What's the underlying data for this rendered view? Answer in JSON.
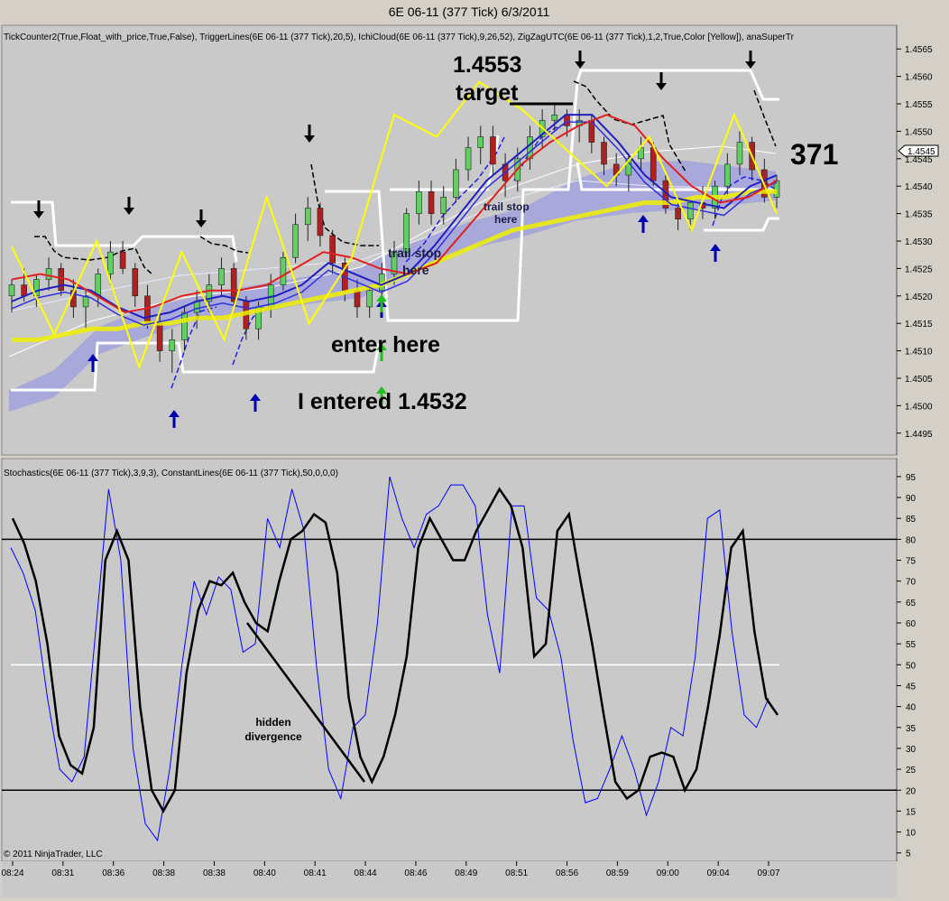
{
  "window": {
    "title": "6E 06-11 (377 Tick)  6/3/2011"
  },
  "price_panel": {
    "indicator_header": "TickCounter2(True,Float_with_price,True,False), TriggerLines(6E 06-11 (377 Tick),20,5), IchiCloud(6E 06-11 (377 Tick),9,26,52), ZigZagUTC(6E 06-11 (377 Tick),1,2,True,Color [Yellow]), anaSuperTr",
    "current_price_tag": "1.4545",
    "tick_counter": "371"
  },
  "stoch_panel": {
    "indicator_header": "Stochastics(6E 06-11 (377 Tick),3,9,3), ConstantLines(6E 06-11 (377 Tick),50,0,0,0)"
  },
  "annotations": {
    "target_price": "1.4553",
    "target_word": "target",
    "trail_stop_1_line1": "trail stop",
    "trail_stop_1_line2": "here",
    "trail_stop_2_line1": "trail stop",
    "trail_stop_2_line2": "here",
    "enter_here": "enter here",
    "entered": "I entered 1.4532",
    "hidden_div_line1": "hidden",
    "hidden_div_line2": "divergence"
  },
  "footer": {
    "copyright": "© 2011 NinjaTrader, LLC"
  },
  "chart_data": [
    {
      "type": "line",
      "panel": "price",
      "title": "6E 06-11 (377 Tick)  6/3/2011",
      "ylim": [
        1.4492,
        1.4568
      ],
      "yticks": [
        1.4495,
        1.45,
        1.4505,
        1.451,
        1.4515,
        1.452,
        1.4525,
        1.453,
        1.4535,
        1.454,
        1.4545,
        1.455,
        1.4555,
        1.456,
        1.4565
      ],
      "xticks": [
        "08:24",
        "08:31",
        "08:36",
        "08:38",
        "08:38",
        "08:40",
        "08:41",
        "08:44",
        "08:46",
        "08:49",
        "08:51",
        "08:56",
        "08:59",
        "09:00",
        "09:04",
        "09:07"
      ],
      "series": [
        {
          "color": "#000000",
          "ohlc": [
            [
              1.452,
              1.4523,
              1.4517,
              1.4522
            ],
            [
              1.4522,
              1.4525,
              1.4519,
              1.452
            ],
            [
              1.452,
              1.4524,
              1.4518,
              1.4523
            ],
            [
              1.4523,
              1.4527,
              1.4521,
              1.4525
            ],
            [
              1.4525,
              1.4526,
              1.452,
              1.4521
            ],
            [
              1.4521,
              1.4523,
              1.4516,
              1.4518
            ],
            [
              1.4518,
              1.4521,
              1.4514,
              1.452
            ],
            [
              1.452,
              1.4525,
              1.4518,
              1.4524
            ],
            [
              1.4524,
              1.453,
              1.4522,
              1.4528
            ],
            [
              1.4528,
              1.453,
              1.4524,
              1.4525
            ],
            [
              1.4525,
              1.4526,
              1.4518,
              1.452
            ],
            [
              1.452,
              1.4522,
              1.4514,
              1.4515
            ],
            [
              1.4515,
              1.4517,
              1.4508,
              1.451
            ],
            [
              1.451,
              1.4514,
              1.4506,
              1.4512
            ],
            [
              1.4512,
              1.4518,
              1.451,
              1.4517
            ],
            [
              1.4517,
              1.4521,
              1.4514,
              1.4519
            ],
            [
              1.4519,
              1.4524,
              1.4517,
              1.4522
            ],
            [
              1.4522,
              1.4527,
              1.452,
              1.4525
            ],
            [
              1.4525,
              1.4526,
              1.4518,
              1.4519
            ],
            [
              1.4519,
              1.452,
              1.4512,
              1.4514
            ],
            [
              1.4514,
              1.4519,
              1.4512,
              1.4518
            ],
            [
              1.4518,
              1.4524,
              1.4516,
              1.4522
            ],
            [
              1.4522,
              1.4528,
              1.4521,
              1.4527
            ],
            [
              1.4527,
              1.4535,
              1.4526,
              1.4533
            ],
            [
              1.4533,
              1.4538,
              1.453,
              1.4536
            ],
            [
              1.4536,
              1.4537,
              1.4529,
              1.4531
            ],
            [
              1.4531,
              1.4532,
              1.4524,
              1.4526
            ],
            [
              1.4526,
              1.4527,
              1.4519,
              1.4521
            ],
            [
              1.4521,
              1.4523,
              1.4516,
              1.4518
            ],
            [
              1.4518,
              1.4522,
              1.4516,
              1.4521
            ],
            [
              1.4521,
              1.4526,
              1.4519,
              1.4524
            ],
            [
              1.4524,
              1.453,
              1.4522,
              1.4528
            ],
            [
              1.4528,
              1.4536,
              1.4527,
              1.4535
            ],
            [
              1.4535,
              1.4541,
              1.4533,
              1.4539
            ],
            [
              1.4539,
              1.4541,
              1.4533,
              1.4535
            ],
            [
              1.4535,
              1.454,
              1.4533,
              1.4538
            ],
            [
              1.4538,
              1.4545,
              1.4537,
              1.4543
            ],
            [
              1.4543,
              1.4549,
              1.4541,
              1.4547
            ],
            [
              1.4547,
              1.4551,
              1.4544,
              1.4549
            ],
            [
              1.4549,
              1.4551,
              1.4542,
              1.4544
            ],
            [
              1.4544,
              1.4546,
              1.4538,
              1.4541
            ],
            [
              1.4541,
              1.4547,
              1.4539,
              1.4545
            ],
            [
              1.4545,
              1.4551,
              1.4543,
              1.4549
            ],
            [
              1.4549,
              1.4554,
              1.4547,
              1.4552
            ],
            [
              1.4552,
              1.4555,
              1.455,
              1.4553
            ],
            [
              1.4553,
              1.4554,
              1.4549,
              1.4551
            ],
            [
              1.4551,
              1.4554,
              1.4548,
              1.4552
            ],
            [
              1.4552,
              1.4553,
              1.4546,
              1.4548
            ],
            [
              1.4548,
              1.4549,
              1.4542,
              1.4544
            ],
            [
              1.4544,
              1.4546,
              1.454,
              1.4542
            ],
            [
              1.4542,
              1.4546,
              1.4539,
              1.4545
            ],
            [
              1.4545,
              1.4549,
              1.4543,
              1.4547
            ],
            [
              1.4547,
              1.4548,
              1.454,
              1.4541
            ],
            [
              1.4541,
              1.4542,
              1.4535,
              1.4536
            ],
            [
              1.4536,
              1.4538,
              1.4532,
              1.4534
            ],
            [
              1.4534,
              1.4538,
              1.4532,
              1.4537
            ],
            [
              1.4537,
              1.454,
              1.4534,
              1.4536
            ],
            [
              1.4536,
              1.4541,
              1.4534,
              1.454
            ],
            [
              1.454,
              1.4546,
              1.4538,
              1.4544
            ],
            [
              1.4544,
              1.455,
              1.4542,
              1.4548
            ],
            [
              1.4548,
              1.4549,
              1.4541,
              1.4543
            ],
            [
              1.4543,
              1.4545,
              1.4537,
              1.4538
            ],
            [
              1.4538,
              1.4542,
              1.4536,
              1.4541
            ]
          ]
        },
        {
          "name_hidden": true,
          "color": "#f0f000",
          "values": [
            1.4512,
            1.4512,
            1.4513,
            1.4514,
            1.4514,
            1.4515,
            1.4515,
            1.4516,
            1.4516,
            1.4517,
            1.4518,
            1.4519,
            1.452,
            1.4521,
            1.4522,
            1.4524,
            1.4526,
            1.4528,
            1.453,
            1.4532,
            1.4533,
            1.4534,
            1.4535,
            1.4536,
            1.4537,
            1.4537,
            1.4538,
            1.4538,
            1.4539,
            1.4539
          ]
        },
        {
          "color": "#3030d0",
          "values": [
            1.4519,
            1.4521,
            1.4522,
            1.4521,
            1.4518,
            1.4516,
            1.4517,
            1.4519,
            1.452,
            1.4519,
            1.452,
            1.4522,
            1.4526,
            1.4524,
            1.4522,
            1.4524,
            1.4529,
            1.4535,
            1.4541,
            1.4545,
            1.4549,
            1.4553,
            1.4553,
            1.4548,
            1.4542,
            1.4538,
            1.4537,
            1.4536,
            1.454,
            1.4542
          ]
        },
        {
          "color": "#e02020",
          "values": [
            1.4523,
            1.4524,
            1.4523,
            1.452,
            1.4517,
            1.4518,
            1.452,
            1.4521,
            1.4521,
            1.4522,
            1.4525,
            1.4528,
            1.4527,
            1.4525,
            1.4524,
            1.4526,
            1.4532,
            1.4538,
            1.4544,
            1.4548,
            1.4551,
            1.4553,
            1.4551,
            1.4545,
            1.454,
            1.4537,
            1.4538,
            1.4541
          ]
        },
        {
          "color": "#ffff00",
          "values": [
            1.4529,
            1.4513,
            1.453,
            1.4507,
            1.4528,
            1.4512,
            1.4538,
            1.4515,
            1.4527,
            1.4553,
            1.4549,
            1.4559,
            1.4554,
            1.4547,
            1.454,
            1.4549,
            1.4532,
            1.4553,
            1.4535
          ]
        }
      ]
    },
    {
      "type": "line",
      "panel": "stochastics",
      "ylim": [
        3,
        98
      ],
      "yticks": [
        5,
        10,
        15,
        20,
        25,
        30,
        35,
        40,
        45,
        50,
        55,
        60,
        65,
        70,
        75,
        80,
        85,
        90,
        95
      ],
      "reference_lines": [
        20,
        50,
        80
      ],
      "series": [
        {
          "color": "#0000ff",
          "values": [
            78,
            72,
            63,
            42,
            25,
            22,
            28,
            60,
            92,
            75,
            30,
            12,
            8,
            25,
            50,
            70,
            62,
            71,
            68,
            53,
            55,
            85,
            78,
            92,
            82,
            50,
            25,
            18,
            35,
            38,
            60,
            95,
            85,
            78,
            86,
            88,
            93,
            93,
            88,
            62,
            48,
            88,
            88,
            66,
            63,
            52,
            32,
            17,
            18,
            25,
            33,
            25,
            14,
            22,
            35,
            33,
            52,
            85,
            87,
            58,
            38,
            35,
            42
          ]
        },
        {
          "color": "#000000",
          "values": [
            85,
            79,
            70,
            55,
            33,
            26,
            24,
            35,
            75,
            82,
            75,
            40,
            20,
            15,
            20,
            48,
            63,
            70,
            69,
            72,
            65,
            60,
            58,
            70,
            80,
            82,
            86,
            84,
            72,
            42,
            28,
            22,
            28,
            38,
            52,
            78,
            85,
            80,
            75,
            75,
            82,
            87,
            92,
            88,
            78,
            52,
            55,
            82,
            86,
            70,
            55,
            38,
            22,
            18,
            20,
            28,
            29,
            28,
            20,
            25,
            40,
            57,
            78,
            82,
            58,
            42,
            38
          ]
        },
        {
          "color": "#000000",
          "values": [
            60,
            22
          ]
        }
      ]
    }
  ]
}
